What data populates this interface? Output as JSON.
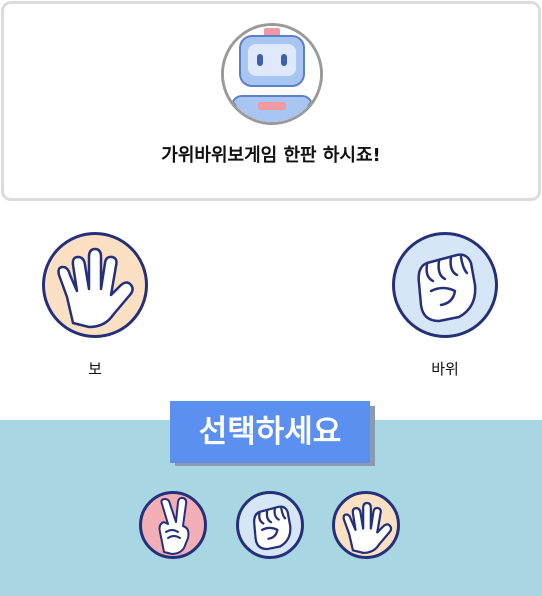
{
  "header": {
    "title": "가위바위보게임 한판 하시죠!",
    "avatar_icon": "robot-icon"
  },
  "players": {
    "left": {
      "label": "보",
      "icon": "paper-hand-icon",
      "color": "#fce0c3"
    },
    "right": {
      "label": "바위",
      "icon": "rock-hand-icon",
      "color": "#d6e6f7"
    }
  },
  "choices": {
    "prompt": "선택하세요",
    "panel_color": "#a8d7e3",
    "prompt_color": "#5b8ff0",
    "options": [
      {
        "name": "scissors",
        "icon": "scissors-hand-icon",
        "color": "#f4aeb5"
      },
      {
        "name": "rock",
        "icon": "rock-hand-icon",
        "color": "#d6e6f7"
      },
      {
        "name": "paper",
        "icon": "paper-hand-icon",
        "color": "#fce0c3"
      }
    ]
  }
}
